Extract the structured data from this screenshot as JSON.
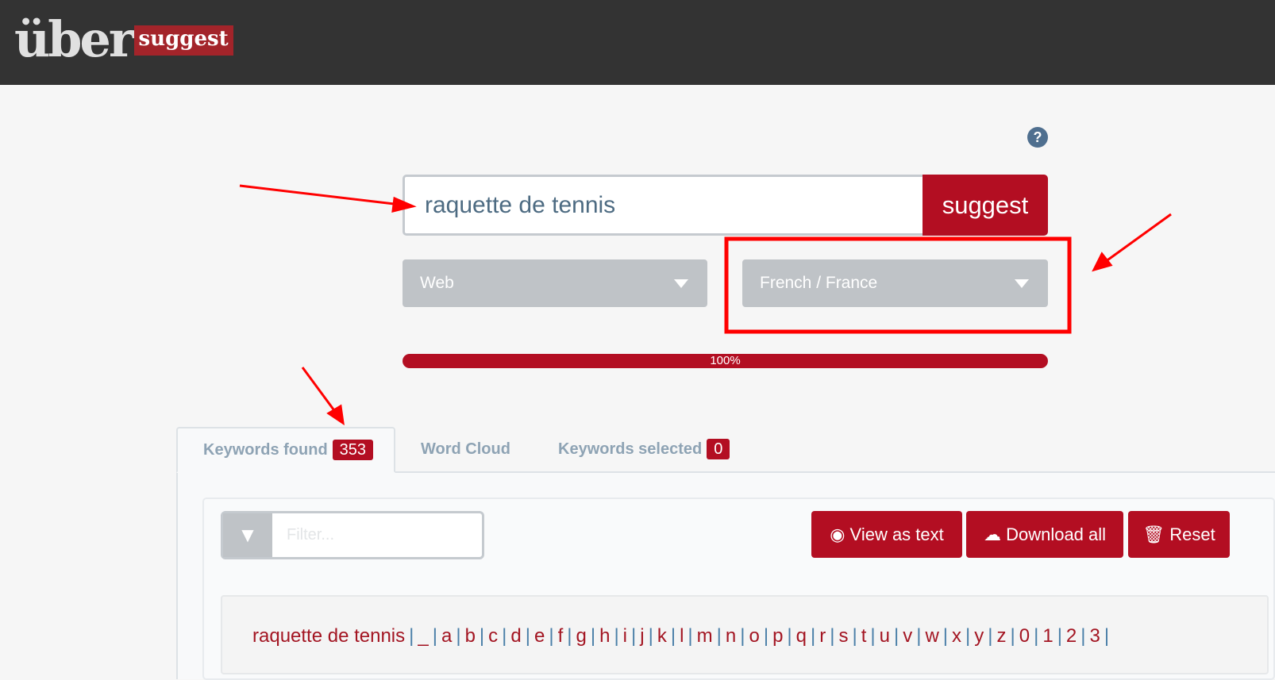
{
  "header": {
    "logo_main": "über",
    "logo_badge": "suggest"
  },
  "help_icon": "question-circle-icon",
  "search": {
    "value": "raquette de tennis",
    "button": "suggest"
  },
  "selects": {
    "source": "Web",
    "language": "French / France"
  },
  "progress": {
    "value": 100,
    "label": "100%"
  },
  "tabs": [
    {
      "label": "Keywords found",
      "count": "353",
      "active": true
    },
    {
      "label": "Word Cloud"
    },
    {
      "label": "Keywords selected",
      "count": "0"
    }
  ],
  "toolbar": {
    "filter_placeholder": "Filter...",
    "view_as_text": "View as text",
    "download_all": "Download all",
    "reset": "Reset"
  },
  "letters": {
    "keyword": "raquette de tennis",
    "items": [
      "_",
      "a",
      "b",
      "c",
      "d",
      "e",
      "f",
      "g",
      "h",
      "i",
      "j",
      "k",
      "l",
      "m",
      "n",
      "o",
      "p",
      "q",
      "r",
      "s",
      "t",
      "u",
      "v",
      "w",
      "x",
      "y",
      "z",
      "0",
      "1",
      "2",
      "3"
    ]
  },
  "colors": {
    "accent": "#b30e22",
    "header": "#333333",
    "annotation": "#ff0000"
  }
}
